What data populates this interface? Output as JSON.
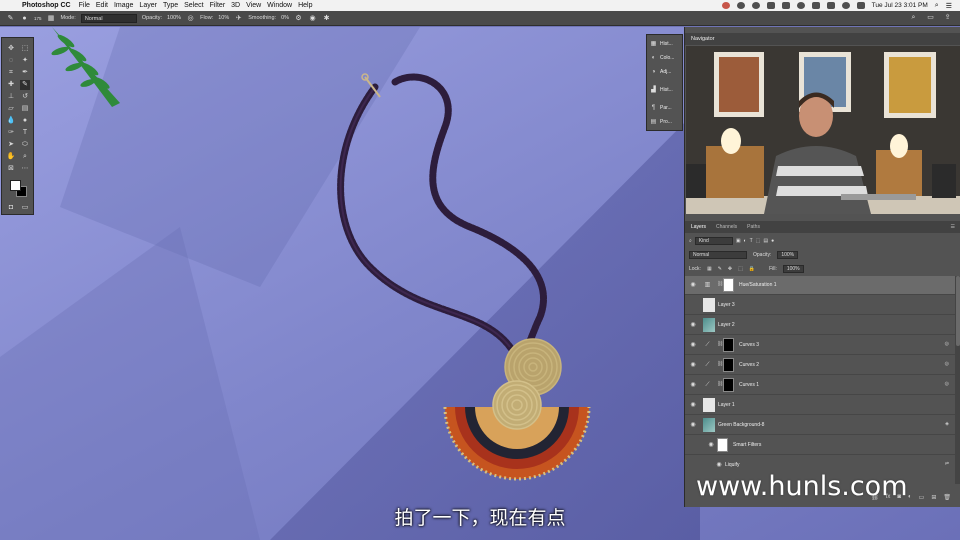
{
  "menubar": {
    "app_name": "Photoshop CC",
    "items": [
      "File",
      "Edit",
      "Image",
      "Layer",
      "Type",
      "Select",
      "Filter",
      "3D",
      "View",
      "Window",
      "Help"
    ],
    "clock": "Tue Jul 23  3:01 PM"
  },
  "options_bar": {
    "brush_size": "175",
    "mode_label": "Mode:",
    "mode_value": "Normal",
    "opacity_label": "Opacity:",
    "opacity_value": "100%",
    "flow_label": "Flow:",
    "flow_value": "10%",
    "smoothing_label": "Smoothing:",
    "smoothing_value": "0%"
  },
  "mini_panels": [
    "Hist...",
    "Colo...",
    "Adj...",
    "Hist...",
    "Par...",
    "Pro..."
  ],
  "navigator": {
    "title": "Navigator"
  },
  "layers_panel": {
    "tabs": [
      "Layers",
      "Channels",
      "Paths"
    ],
    "filter_kind": "Kind",
    "blend_mode": "Normal",
    "opacity_label": "Opacity:",
    "opacity_value": "100%",
    "lock_label": "Lock:",
    "fill_label": "Fill:",
    "fill_value": "100%",
    "layers": [
      {
        "name": "Hue/Saturation 1"
      },
      {
        "name": "Layer 3"
      },
      {
        "name": "Layer 2"
      },
      {
        "name": "Curves 3"
      },
      {
        "name": "Curves 2"
      },
      {
        "name": "Curves 1"
      },
      {
        "name": "Layer 1"
      },
      {
        "name": "Green Background-8"
      },
      {
        "name": "Smart Filters"
      },
      {
        "name": "Liquify"
      }
    ]
  },
  "overlay": {
    "watermark": "www.hunls.com",
    "subtitle": "拍了一下，现在有点"
  },
  "colors": {
    "canvas_bg": "#7d83c9",
    "panel_bg": "#535353",
    "menubar_bg": "#f2f2f2"
  }
}
